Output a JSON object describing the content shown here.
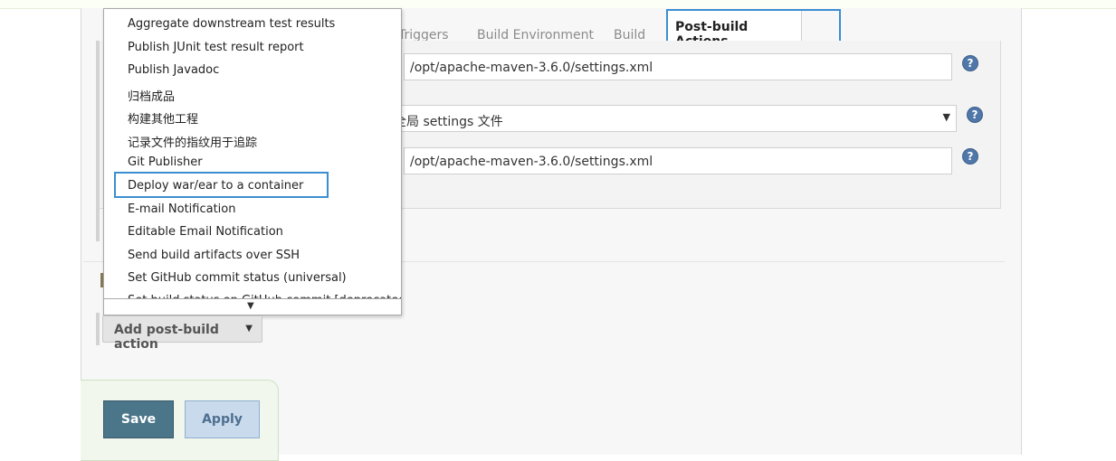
{
  "tabs": {
    "triggers": "Triggers",
    "build_environment": "Build Environment",
    "build": "Build",
    "post_build_actions": "Post-build Actions"
  },
  "settings": {
    "settings_file_value": "/opt/apache-maven-3.6.0/settings.xml",
    "global_settings_select_value": "的全局 settings 文件",
    "global_settings_file_value": "/opt/apache-maven-3.6.0/settings.xml",
    "help_symbol": "?"
  },
  "dropdown": {
    "items": [
      "Aggregate downstream test results",
      "Publish JUnit test result report",
      "Publish Javadoc",
      "归档成品",
      "构建其他工程",
      "记录文件的指纹用于追踪",
      "Git Publisher",
      "Deploy war/ear to a container",
      "E-mail Notification",
      "Editable Email Notification",
      "Send build artifacts over SSH",
      "Set GitHub commit status (universal)",
      "Set build status on GitHub commit [deprecated]"
    ],
    "highlighted": "Deploy war/ear to a container",
    "scroll_arrow": "▼"
  },
  "add_action": {
    "label": "Add post-build action",
    "caret": "▼"
  },
  "buttons": {
    "save": "Save",
    "apply": "Apply"
  },
  "colors": {
    "highlight_border": "#3b8ed1",
    "save_bg": "#4b7589",
    "apply_bg": "#c8daec"
  }
}
